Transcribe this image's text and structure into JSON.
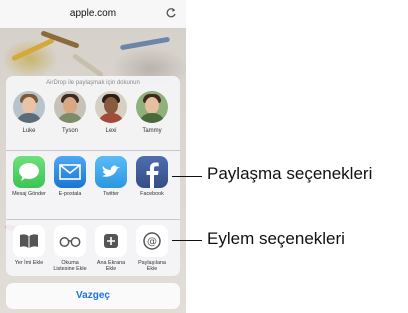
{
  "browser": {
    "url": "apple.com"
  },
  "share_sheet": {
    "airdrop_hint": "AirDrop ile paylaşmak için dokunun",
    "people": [
      {
        "name": "Luke"
      },
      {
        "name": "Tyson"
      },
      {
        "name": "Lexi"
      },
      {
        "name": "Tammy"
      }
    ],
    "apps": [
      {
        "label": "Mesaj Gönder",
        "icon": "messages-icon",
        "color": "#4cd964"
      },
      {
        "label": "E-postala",
        "icon": "mail-icon",
        "color": "#1e88e5"
      },
      {
        "label": "Twitter",
        "icon": "twitter-icon",
        "color": "#3fa9f5"
      },
      {
        "label": "Facebook",
        "icon": "facebook-icon",
        "color": "#3b5998"
      }
    ],
    "actions": [
      {
        "label": "Yer İmi Ekle",
        "icon": "book-icon"
      },
      {
        "label": "Okuma Listesine Ekle",
        "icon": "glasses-icon"
      },
      {
        "label": "Ana Ekrana Ekle",
        "icon": "plus-icon"
      },
      {
        "label": "Paylaşılana Ekle",
        "icon": "at-icon"
      }
    ],
    "cancel_label": "Vazgeç"
  },
  "callouts": {
    "share_options": "Paylaşma seçenekleri",
    "action_options": "Eylem seçenekleri"
  },
  "colors": {
    "accent": "#1a73e8"
  }
}
